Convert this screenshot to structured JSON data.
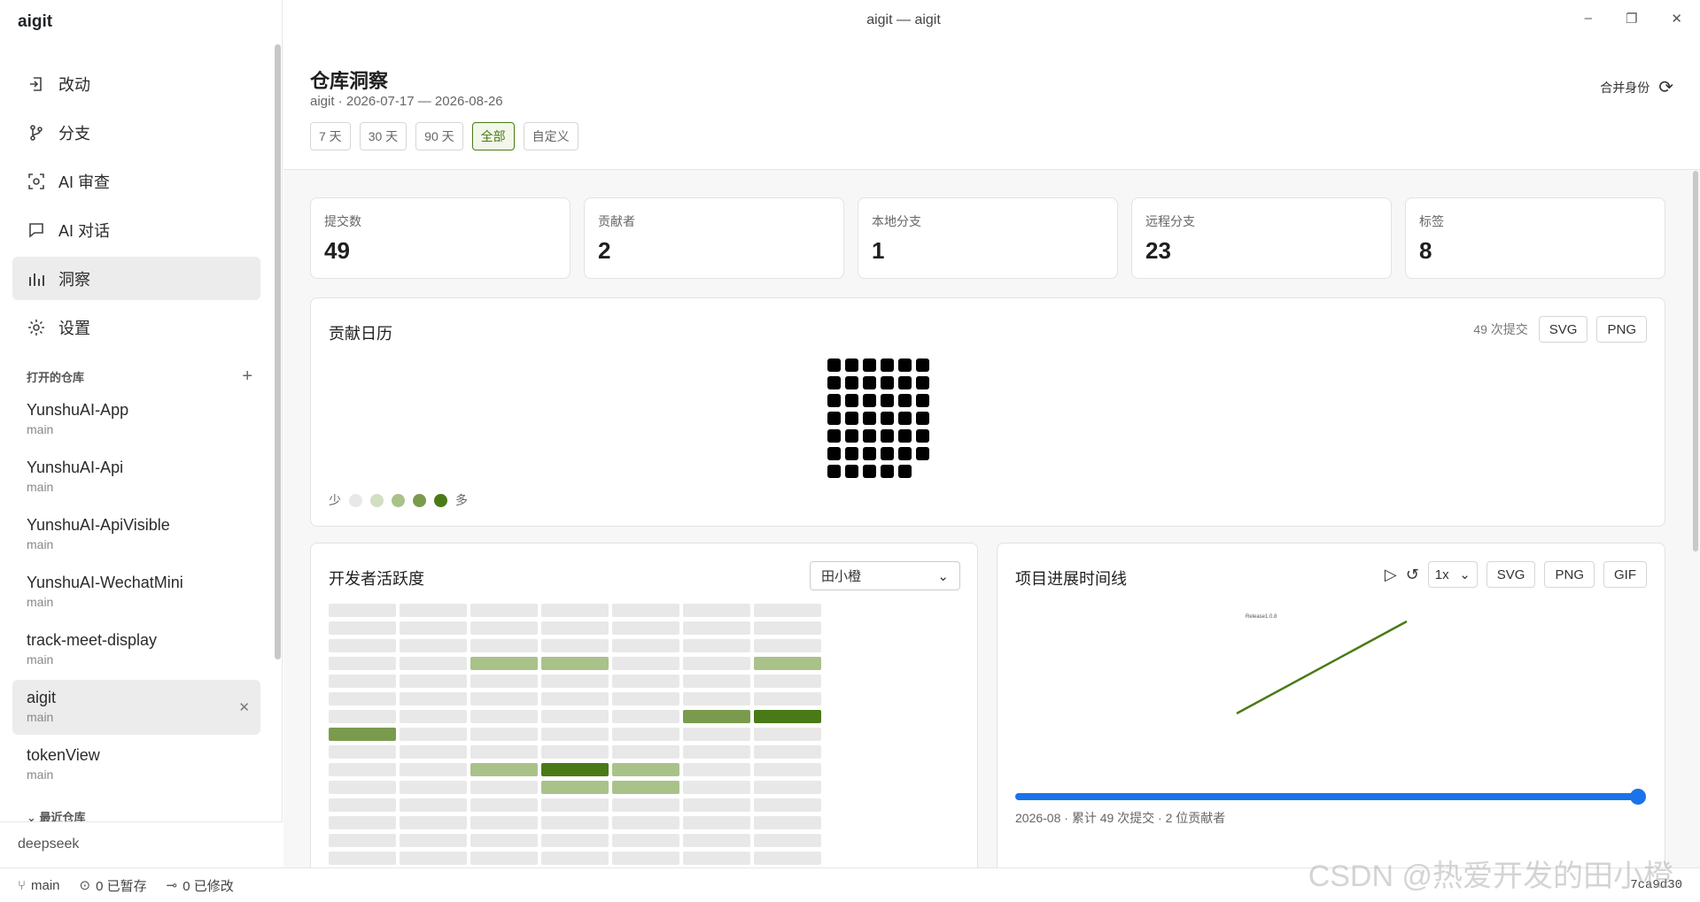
{
  "app": {
    "name": "aigit",
    "window_title": "aigit — aigit"
  },
  "nav": [
    {
      "label": "改动",
      "icon": "changes-icon"
    },
    {
      "label": "分支",
      "icon": "branch-icon"
    },
    {
      "label": "AI 审查",
      "icon": "ai-review-icon"
    },
    {
      "label": "AI 对话",
      "icon": "chat-icon"
    },
    {
      "label": "洞察",
      "icon": "insights-icon",
      "active": true
    },
    {
      "label": "设置",
      "icon": "gear-icon"
    }
  ],
  "open_repos": {
    "title": "打开的仓库",
    "items": [
      {
        "name": "YunshuAI-App",
        "branch": "main"
      },
      {
        "name": "YunshuAI-Api",
        "branch": "main"
      },
      {
        "name": "YunshuAI-ApiVisible",
        "branch": "main"
      },
      {
        "name": "YunshuAI-WechatMini",
        "branch": "main"
      },
      {
        "name": "track-meet-display",
        "branch": "main"
      },
      {
        "name": "aigit",
        "branch": "main",
        "active": true
      },
      {
        "name": "tokenView",
        "branch": "main"
      }
    ]
  },
  "recent_repos": {
    "title": "最近仓库"
  },
  "sidebar_footer": {
    "model": "deepseek"
  },
  "statusbar": {
    "branch": "main",
    "stashed": "0 已暂存",
    "modified": "0 已修改",
    "commit": "7ca9d30"
  },
  "watermark": "CSDN @热爱开发的田小橙",
  "header": {
    "title": "仓库洞察",
    "subtitle": "aigit · 2026-07-17 — 2026-08-26",
    "ranges": [
      {
        "label": "7 天"
      },
      {
        "label": "30 天"
      },
      {
        "label": "90 天"
      },
      {
        "label": "全部",
        "active": true
      },
      {
        "label": "自定义"
      }
    ],
    "merge_label": "合并身份"
  },
  "stats": [
    {
      "label": "提交数",
      "value": "49"
    },
    {
      "label": "贡献者",
      "value": "2"
    },
    {
      "label": "本地分支",
      "value": "1"
    },
    {
      "label": "远程分支",
      "value": "23"
    },
    {
      "label": "标签",
      "value": "8"
    }
  ],
  "calendar": {
    "title": "贡献日历",
    "count": "49 次提交",
    "export": [
      "SVG",
      "PNG"
    ],
    "legend_low": "少",
    "legend_high": "多",
    "legend_colors": [
      "#e8e8e8",
      "#d3dfc3",
      "#a9c28a",
      "#7a9b4e",
      "#4a7a17"
    ],
    "weeks_rows": [
      6,
      6,
      6,
      6,
      6,
      6,
      5
    ]
  },
  "developer": {
    "title": "开发者活跃度",
    "selected": "田小橙",
    "levels": [
      [
        0,
        0,
        0,
        0,
        0,
        0,
        0
      ],
      [
        0,
        0,
        0,
        0,
        0,
        0,
        0
      ],
      [
        0,
        0,
        0,
        0,
        0,
        0,
        0
      ],
      [
        0,
        0,
        2,
        2,
        0,
        0,
        2
      ],
      [
        0,
        0,
        0,
        0,
        0,
        0,
        0
      ],
      [
        0,
        0,
        0,
        0,
        0,
        0,
        0
      ],
      [
        0,
        0,
        0,
        0,
        0,
        3,
        4
      ],
      [
        3,
        0,
        0,
        0,
        0,
        0,
        0
      ],
      [
        0,
        0,
        0,
        0,
        0,
        0,
        0
      ],
      [
        0,
        0,
        2,
        4,
        2,
        0,
        0
      ],
      [
        0,
        0,
        0,
        2,
        2,
        0,
        0
      ],
      [
        0,
        0,
        0,
        0,
        0,
        0,
        0
      ],
      [
        0,
        0,
        0,
        0,
        0,
        0,
        0
      ],
      [
        0,
        0,
        0,
        0,
        0,
        0,
        0
      ],
      [
        0,
        0,
        0,
        0,
        0,
        0,
        0
      ]
    ]
  },
  "timeline": {
    "title": "项目进展时间线",
    "speed": "1x",
    "export": [
      "SVG",
      "PNG",
      "GIF"
    ],
    "release_label": "Release1.0.8",
    "progress": 1.0,
    "caption": "2026-08 · 累计 49 次提交 · 2 位贡献者",
    "line_color": "#4a7a17"
  }
}
